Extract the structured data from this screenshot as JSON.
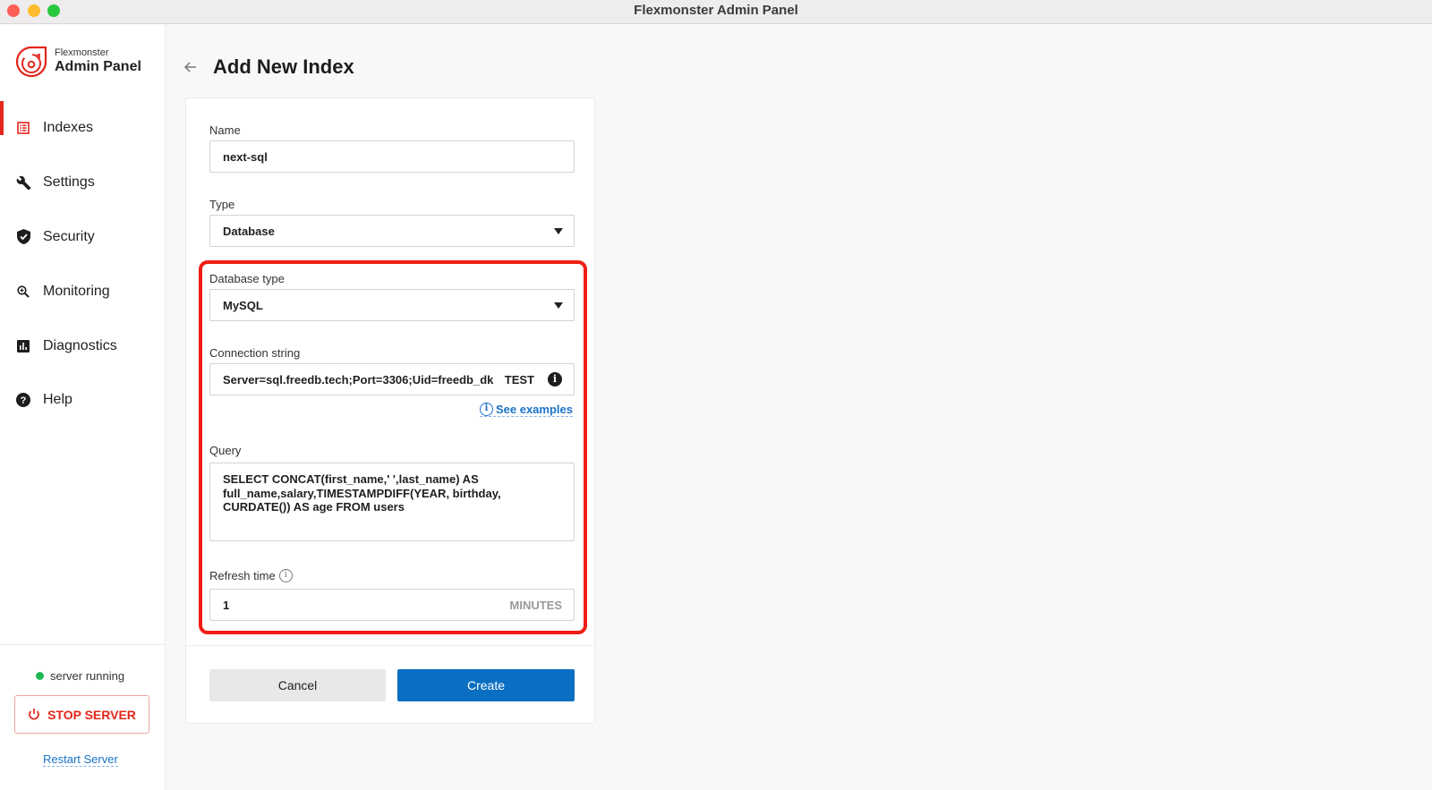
{
  "window": {
    "title": "Flexmonster Admin Panel"
  },
  "sidebar": {
    "brand": {
      "small": "Flexmonster",
      "big": "Admin Panel"
    },
    "items": [
      {
        "label": "Indexes",
        "icon": "list-icon",
        "active": true
      },
      {
        "label": "Settings",
        "icon": "wrench-icon",
        "active": false
      },
      {
        "label": "Security",
        "icon": "shield-check-icon",
        "active": false
      },
      {
        "label": "Monitoring",
        "icon": "zoom-in-icon",
        "active": false
      },
      {
        "label": "Diagnostics",
        "icon": "bar-chart-icon",
        "active": false
      },
      {
        "label": "Help",
        "icon": "help-circle-icon",
        "active": false
      }
    ],
    "status": "server running",
    "stop_button": "STOP SERVER",
    "restart_link": "Restart Server"
  },
  "main": {
    "page_title": "Add New Index",
    "form": {
      "name": {
        "label": "Name",
        "value": "next-sql"
      },
      "type": {
        "label": "Type",
        "value": "Database"
      },
      "database_type": {
        "label": "Database type",
        "value": "MySQL"
      },
      "connection_string": {
        "label": "Connection string",
        "value": "Server=sql.freedb.tech;Port=3306;Uid=freedb_dk",
        "test_label": "TEST",
        "info_icon": "i"
      },
      "see_examples": "See examples",
      "query": {
        "label": "Query",
        "value": "SELECT CONCAT(first_name,' ',last_name) AS\nfull_name,salary,TIMESTAMPDIFF(YEAR, birthday,\nCURDATE()) AS age FROM users"
      },
      "refresh_time": {
        "label": "Refresh time",
        "value": "1",
        "unit": "MINUTES"
      },
      "cancel": "Cancel",
      "create": "Create"
    }
  },
  "colors": {
    "accent_red": "#e2261c",
    "primary_blue": "#0a6fc2",
    "link_blue": "#1a73c8",
    "status_green": "#1db954",
    "highlight_red": "#f01e14"
  }
}
